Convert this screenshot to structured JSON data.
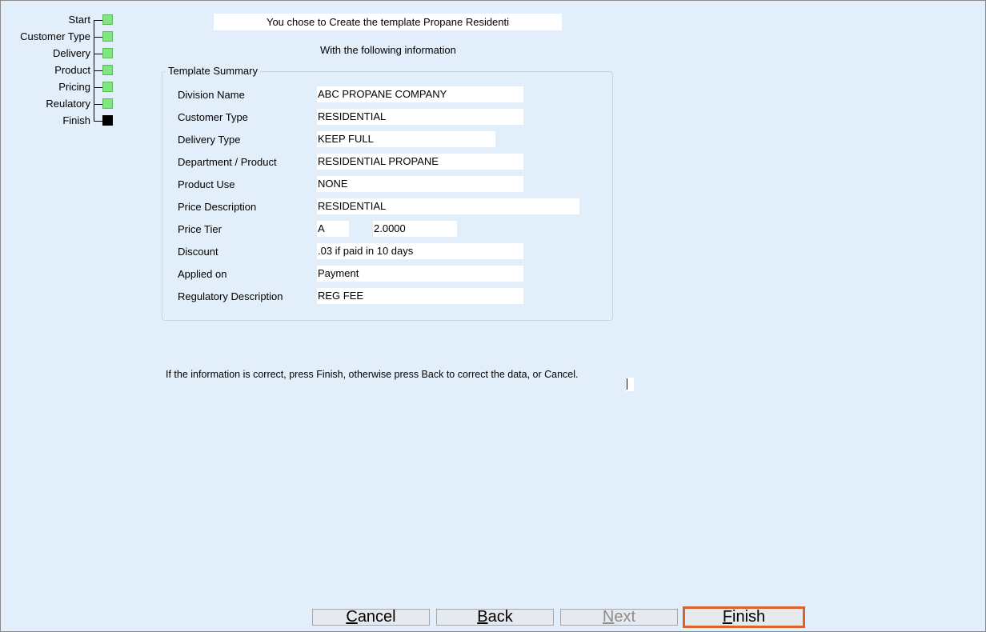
{
  "wizard": {
    "steps": [
      {
        "label": "Start",
        "status": "done"
      },
      {
        "label": "Customer Type",
        "status": "done"
      },
      {
        "label": "Delivery",
        "status": "done"
      },
      {
        "label": "Product",
        "status": "done"
      },
      {
        "label": "Pricing",
        "status": "done"
      },
      {
        "label": "Reulatory",
        "status": "done"
      },
      {
        "label": "Finish",
        "status": "current"
      }
    ]
  },
  "header": {
    "title": "You chose to Create the template Propane Residenti",
    "subtitle": "With the following information"
  },
  "summary": {
    "legend": "Template Summary",
    "fields": [
      {
        "label": "Division Name",
        "value": "ABC PROPANE COMPANY"
      },
      {
        "label": "Customer Type",
        "value": "RESIDENTIAL"
      },
      {
        "label": "Delivery Type",
        "value": "KEEP FULL"
      },
      {
        "label": "Department / Product",
        "value": "RESIDENTIAL PROPANE"
      },
      {
        "label": "Product Use",
        "value": "NONE"
      },
      {
        "label": "Price Description",
        "value": "RESIDENTIAL"
      },
      {
        "label": "Price Tier",
        "value": "A",
        "value2": "2.0000"
      },
      {
        "label": "Discount",
        "value": ".03 if paid in 10 days"
      },
      {
        "label": "Applied on",
        "value": "Payment"
      },
      {
        "label": "Regulatory Description",
        "value": "REG FEE"
      }
    ]
  },
  "instructions": "If the information is correct, press Finish, otherwise press Back to correct the data, or Cancel.",
  "buttons": {
    "cancel": {
      "hotkey": "C",
      "rest": "ancel"
    },
    "back": {
      "hotkey": "B",
      "rest": "ack"
    },
    "next": {
      "hotkey": "N",
      "rest": "ext"
    },
    "finish": {
      "hotkey": "F",
      "rest": "inish"
    }
  },
  "colors": {
    "background": "#e3eefb",
    "step_done": "#7fe77f",
    "step_current": "#000000",
    "focus_border": "#d8642c"
  }
}
